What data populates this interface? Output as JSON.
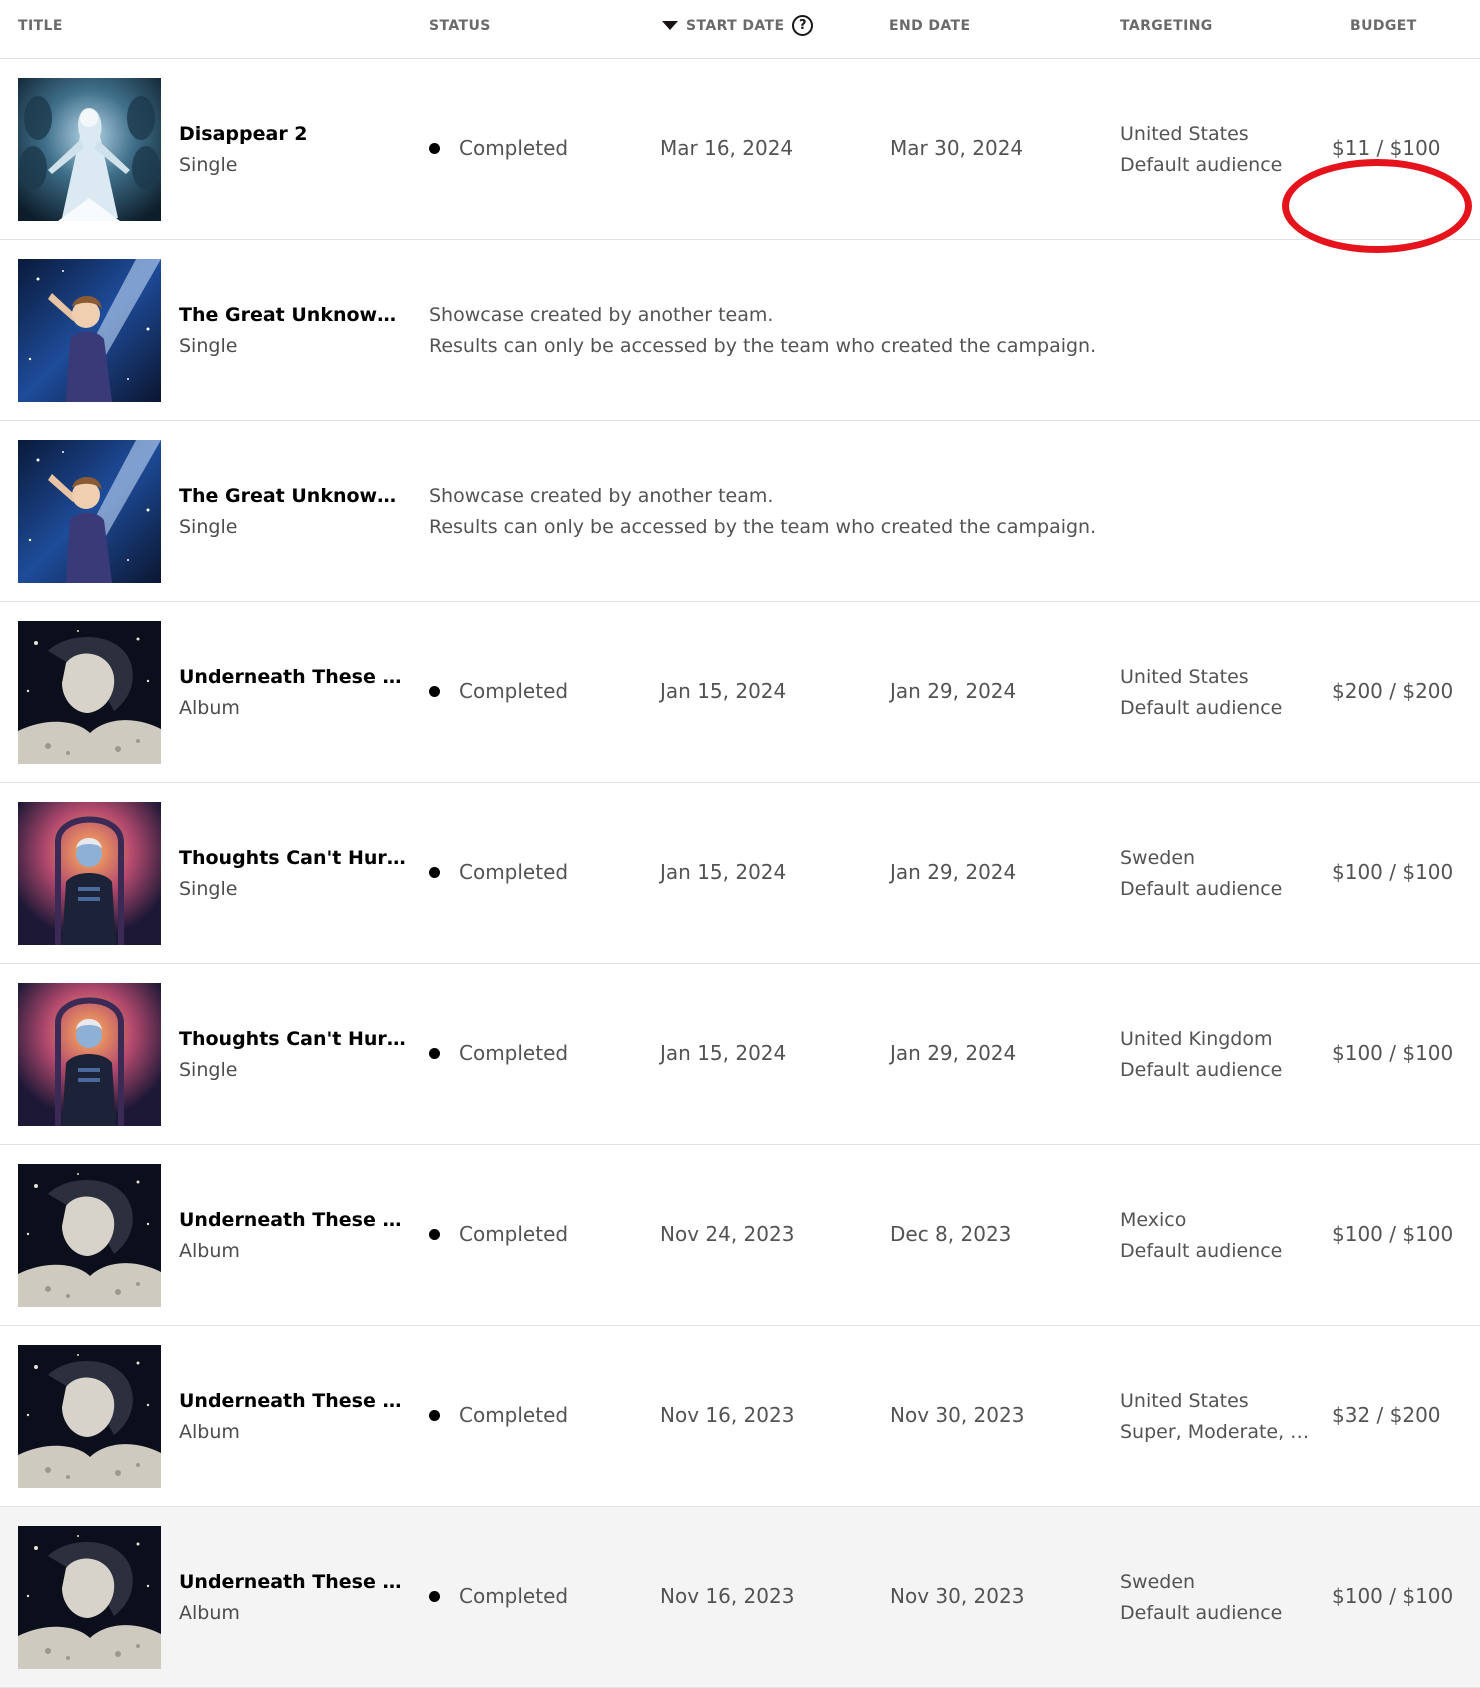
{
  "columns": {
    "title": "TITLE",
    "status": "STATUS",
    "start_date": "START DATE",
    "end_date": "END DATE",
    "targeting": "TARGETING",
    "budget": "BUDGET"
  },
  "sort": {
    "column": "START DATE",
    "direction": "descending"
  },
  "icons": {
    "sort": "caret-down-icon",
    "help": "help-circle-icon"
  },
  "colors": {
    "highlight_ring": "#e5131b",
    "status_dot": "#000000"
  },
  "rows": [
    {
      "art": "disappear-2-cover",
      "title": "Disappear 2",
      "type": "Single",
      "status": "Completed",
      "start": "Mar 16, 2024",
      "end": "Mar 30, 2024",
      "country": "United States",
      "audience": "Default audience",
      "budget": "$11 / $100",
      "highlighted": true
    },
    {
      "art": "great-unknown-cover",
      "title": "The Great Unknown…",
      "type": "Single",
      "notice_1": "Showcase created by another team.",
      "notice_2": "Results can only be accessed by the team who created the campaign."
    },
    {
      "art": "great-unknown-cover",
      "title": "The Great Unknown…",
      "type": "Single",
      "notice_1": "Showcase created by another team.",
      "notice_2": "Results can only be accessed by the team who created the campaign."
    },
    {
      "art": "underneath-cover",
      "title": "Underneath These …",
      "type": "Album",
      "status": "Completed",
      "start": "Jan 15, 2024",
      "end": "Jan 29, 2024",
      "country": "United States",
      "audience": "Default audience",
      "budget": "$200 / $200"
    },
    {
      "art": "thoughts-cover",
      "title": "Thoughts Can't Hur…",
      "type": "Single",
      "status": "Completed",
      "start": "Jan 15, 2024",
      "end": "Jan 29, 2024",
      "country": "Sweden",
      "audience": "Default audience",
      "budget": "$100 / $100"
    },
    {
      "art": "thoughts-cover",
      "title": "Thoughts Can't Hur…",
      "type": "Single",
      "status": "Completed",
      "start": "Jan 15, 2024",
      "end": "Jan 29, 2024",
      "country": "United Kingdom",
      "audience": "Default audience",
      "budget": "$100 / $100"
    },
    {
      "art": "underneath-cover",
      "title": "Underneath These …",
      "type": "Album",
      "status": "Completed",
      "start": "Nov 24, 2023",
      "end": "Dec 8, 2023",
      "country": "Mexico",
      "audience": "Default audience",
      "budget": "$100 / $100"
    },
    {
      "art": "underneath-cover",
      "title": "Underneath These …",
      "type": "Album",
      "status": "Completed",
      "start": "Nov 16, 2023",
      "end": "Nov 30, 2023",
      "country": "United States",
      "audience": "Super, Moderate, …",
      "budget": "$32 / $200"
    },
    {
      "art": "underneath-cover",
      "title": "Underneath These …",
      "type": "Album",
      "status": "Completed",
      "start": "Nov 16, 2023",
      "end": "Nov 30, 2023",
      "country": "Sweden",
      "audience": "Default audience",
      "budget": "$100 / $100",
      "hovered": true
    }
  ]
}
